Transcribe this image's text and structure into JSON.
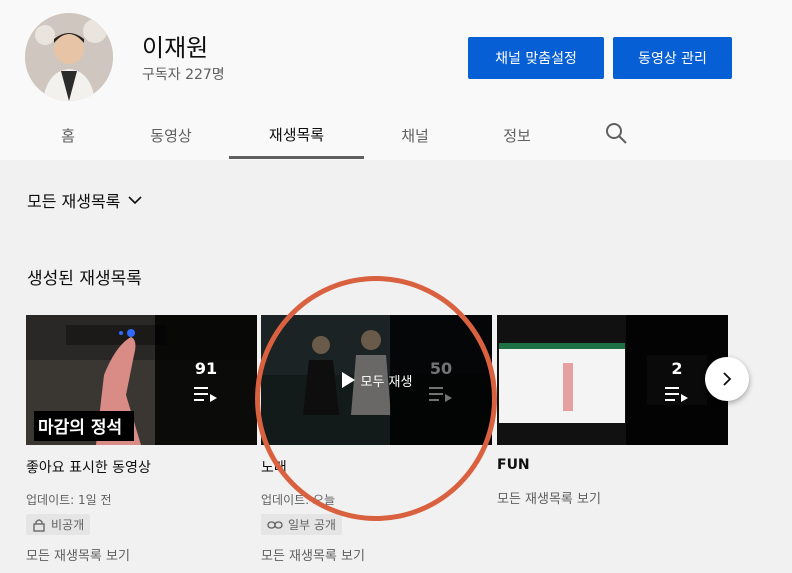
{
  "channel": {
    "name": "이재원",
    "subscribers": "구독자 227명",
    "customize_label": "채널 맞춤설정",
    "manage_label": "동영상 관리"
  },
  "tabs": [
    {
      "label": "홈"
    },
    {
      "label": "동영상"
    },
    {
      "label": "재생목록"
    },
    {
      "label": "채널"
    },
    {
      "label": "정보"
    }
  ],
  "filter": {
    "label": "모든 재생목록"
  },
  "section": {
    "title": "생성된 재생목록"
  },
  "playlists": [
    {
      "title": "좋아요 표시한 동영상",
      "count": "91",
      "updated": "업데이트: 1일 전",
      "privacy": "비공개",
      "view_all": "모든 재생목록 보기",
      "thumb_caption": "마감의 정석"
    },
    {
      "title": "노래",
      "count": "50",
      "updated": "업데이트: 오늘",
      "privacy": "일부 공개",
      "view_all": "모든 재생목록 보기",
      "hover_label": "모두 재생"
    },
    {
      "title": "FUN",
      "count": "2",
      "view_all": "모든 재생목록 보기"
    }
  ],
  "colors": {
    "accent": "#065fd4",
    "annotation": "#d9613f"
  }
}
